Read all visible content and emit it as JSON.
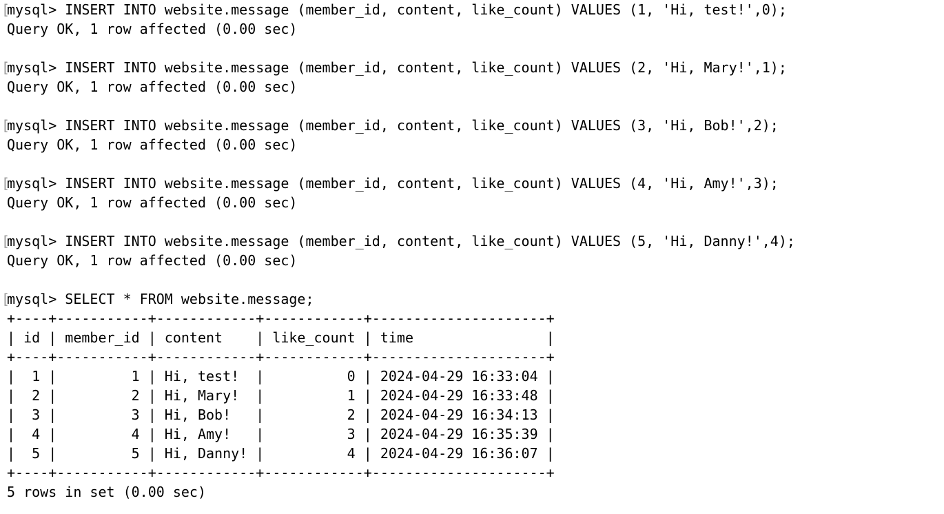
{
  "terminal": {
    "blocks": [
      {
        "prompt": "mysql> INSERT INTO website.message (member_id, content, like_count) VALUES (1, 'Hi, test!',0);",
        "output": "Query OK, 1 row affected (0.00 sec)"
      },
      {
        "prompt": "mysql> INSERT INTO website.message (member_id, content, like_count) VALUES (2, 'Hi, Mary!',1);",
        "output": "Query OK, 1 row affected (0.00 sec)"
      },
      {
        "prompt": "mysql> INSERT INTO website.message (member_id, content, like_count) VALUES (3, 'Hi, Bob!',2);",
        "output": "Query OK, 1 row affected (0.00 sec)"
      },
      {
        "prompt": "mysql> INSERT INTO website.message (member_id, content, like_count) VALUES (4, 'Hi, Amy!',3);",
        "output": "Query OK, 1 row affected (0.00 sec)"
      },
      {
        "prompt": "mysql> INSERT INTO website.message (member_id, content, like_count) VALUES (5, 'Hi, Danny!',4);",
        "output": "Query OK, 1 row affected (0.00 sec)"
      }
    ],
    "select": {
      "prompt": "mysql> SELECT * FROM website.message;",
      "table_lines": [
        "+----+-----------+------------+------------+---------------------+",
        "| id | member_id | content    | like_count | time                |",
        "+----+-----------+------------+------------+---------------------+",
        "|  1 |         1 | Hi, test!  |          0 | 2024-04-29 16:33:04 |",
        "|  2 |         2 | Hi, Mary!  |          1 | 2024-04-29 16:33:48 |",
        "|  3 |         3 | Hi, Bob!   |          2 | 2024-04-29 16:34:13 |",
        "|  4 |         4 | Hi, Amy!   |          3 | 2024-04-29 16:35:39 |",
        "|  5 |         5 | Hi, Danny! |          4 | 2024-04-29 16:36:07 |",
        "+----+-----------+------------+------------+---------------------+"
      ],
      "summary": "5 rows in set (0.00 sec)"
    },
    "prompt_bracket": "["
  }
}
